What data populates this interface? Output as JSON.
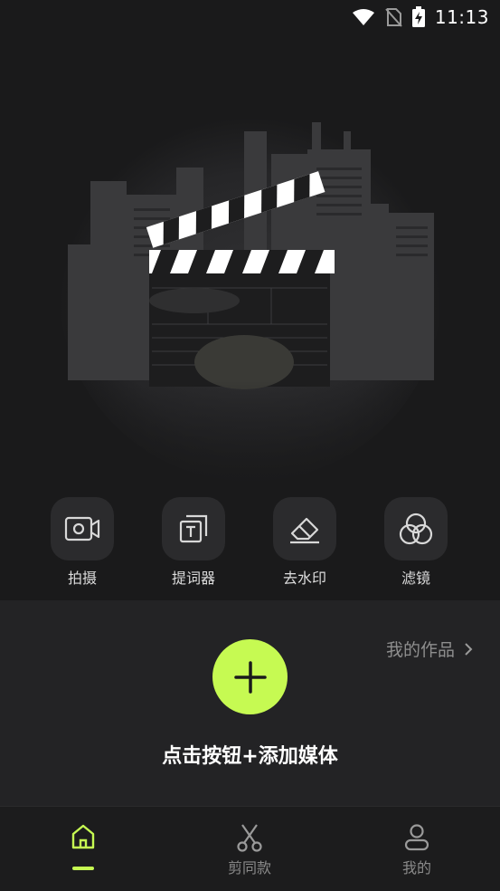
{
  "status_bar": {
    "time": "11:13"
  },
  "tools": [
    {
      "id": "shoot",
      "label": "拍摄",
      "icon": "video-camera-icon"
    },
    {
      "id": "teleprompter",
      "label": "提词器",
      "icon": "teleprompter-icon"
    },
    {
      "id": "remove-watermark",
      "label": "去水印",
      "icon": "eraser-icon"
    },
    {
      "id": "filter",
      "label": "滤镜",
      "icon": "filter-circles-icon"
    }
  ],
  "create_panel": {
    "my_works_label": "我的作品",
    "add_hint": "点击按钮+添加媒体"
  },
  "bottom_nav": {
    "items": [
      {
        "label": "",
        "icon": "home-icon",
        "active": true
      },
      {
        "label": "剪同款",
        "icon": "scissors-icon",
        "active": false
      },
      {
        "label": "我的",
        "icon": "person-icon",
        "active": false
      }
    ]
  },
  "colors": {
    "accent": "#c6fa52",
    "background": "#1a1a1b",
    "panel": "#232325",
    "tool_tile": "#2b2b2d"
  }
}
